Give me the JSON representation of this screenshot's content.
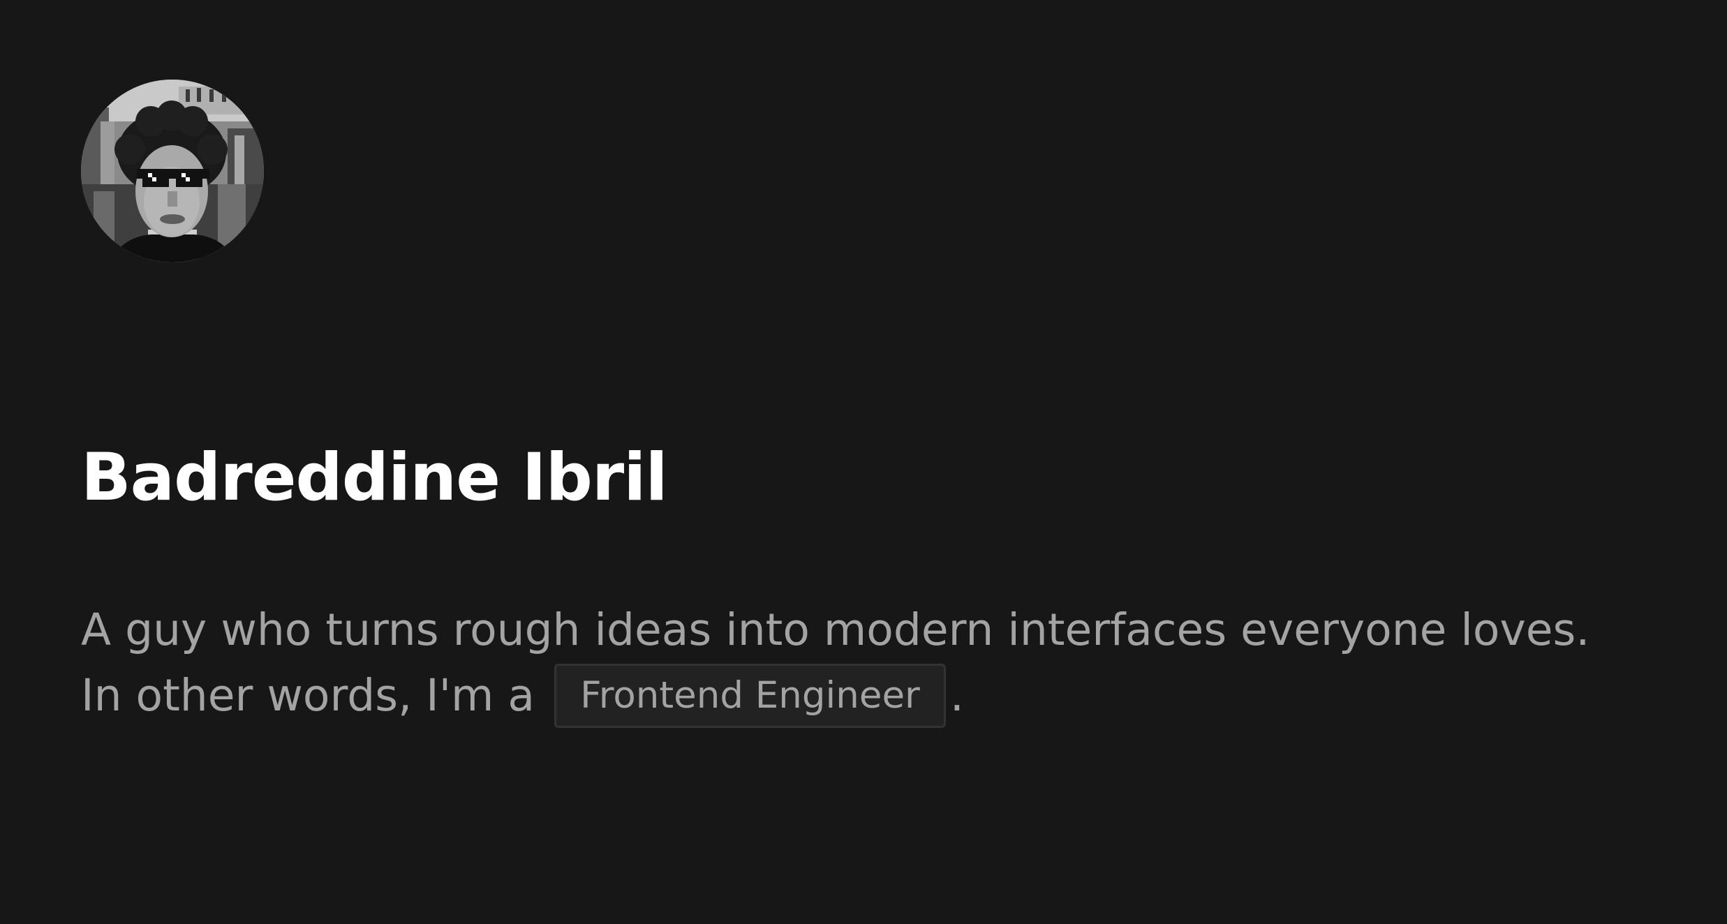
{
  "profile": {
    "avatar_alt": "Profile photo",
    "name": "Badreddine Ibril",
    "bio_line1": "A guy who turns rough ideas into modern interfaces everyone loves.",
    "bio_line2_prefix": "In other words, I'm a",
    "role": "Frontend Engineer",
    "bio_line2_suffix": "."
  },
  "colors": {
    "background": "#171717",
    "heading": "#ffffff",
    "body_text": "#a3a3a3",
    "badge_bg": "#222222",
    "badge_border": "#333333"
  }
}
